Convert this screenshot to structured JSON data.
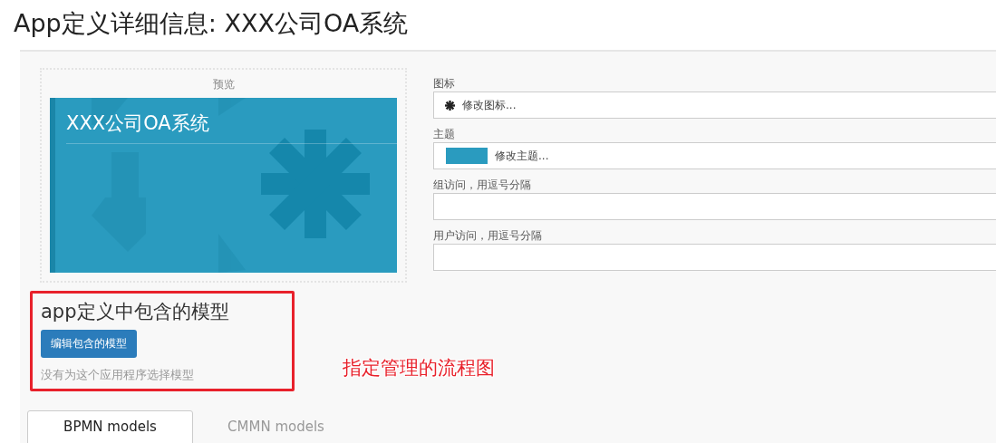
{
  "page_title": "App定义详细信息: XXX公司OA系统",
  "preview": {
    "label": "预览",
    "tile_title": "XXX公司OA系统"
  },
  "fields": [
    {
      "label": "图标",
      "kind": "icon",
      "button": "修改图标..."
    },
    {
      "label": "主题",
      "kind": "theme",
      "button": "修改主题..."
    },
    {
      "label": "组访问，用逗号分隔",
      "kind": "text"
    },
    {
      "label": "用户访问，用逗号分隔",
      "kind": "text"
    }
  ],
  "models": {
    "heading": "app定义中包含的模型",
    "button": "编辑包含的模型",
    "empty_text": "没有为这个应用程序选择模型"
  },
  "annotation": "指定管理的流程图",
  "tabs": [
    {
      "label": "BPMN models",
      "selected": true
    },
    {
      "label": "CMMN models",
      "selected": false
    }
  ]
}
